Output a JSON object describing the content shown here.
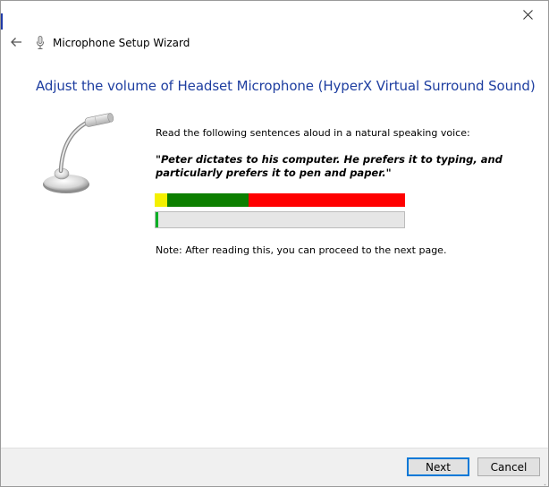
{
  "window": {
    "title": "Microphone Setup Wizard",
    "close_icon": "close-icon",
    "back_icon": "back-arrow-icon",
    "title_icon": "microphone-icon"
  },
  "main": {
    "heading": "Adjust the volume of Headset Microphone (HyperX Virtual Surround Sound)",
    "instruction": "Read the following sentences aloud in a natural speaking voice:",
    "sentence": "\"Peter dictates to his computer. He prefers it to typing, and particularly prefers it to pen and paper.\"",
    "note": "Note: After reading this, you can proceed to the next page.",
    "level_progress": 0.01,
    "meter_colors": {
      "low": "#f4f000",
      "good": "#0c7f00",
      "high": "#ff0000"
    },
    "progress_fill_color": "#06b025"
  },
  "footer": {
    "next_label": "Next",
    "cancel_label": "Cancel"
  },
  "colors": {
    "heading": "#1e3ea0",
    "primary_button_border": "#0078d7"
  }
}
